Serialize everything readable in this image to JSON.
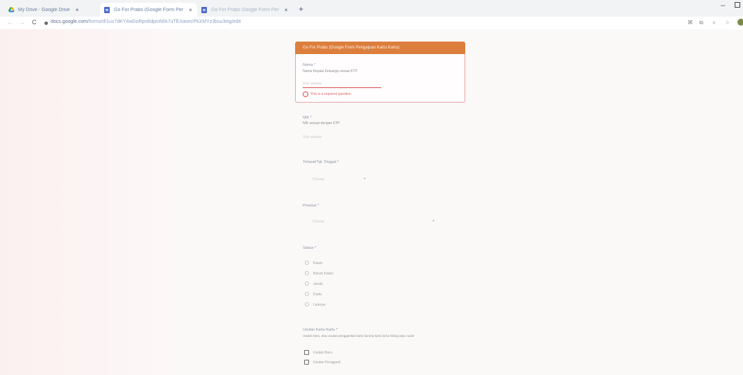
{
  "browser": {
    "tabs": [
      {
        "title": "My Drive - Google Drive",
        "icon": "google-drive-icon",
        "active": false
      },
      {
        "title": "Go For Prabs (Google Form Per",
        "icon": "google-forms-icon",
        "active": true
      },
      {
        "title": "Go For Prabs Google Form Per",
        "icon": "google-forms-icon",
        "active": false
      }
    ],
    "close_glyph": "×",
    "new_tab_glyph": "+",
    "minimize_glyph": "–",
    "url_host": "docs.google.com",
    "url_path": "/forms/d/1uz7dKY4wDoRpn6dpmNfA7uTEXaom/PkXMYz3bsu3eig/edit",
    "back_glyph": "←",
    "forward_glyph": "→",
    "reload_glyph": "C",
    "toolbar_icons": [
      "share-icon",
      "extension-icon",
      "search-icon",
      "star-icon"
    ]
  },
  "form": {
    "header_title": "Go For Prabs (Google Form Pengajuan Kartu Kartu)",
    "name_question": {
      "label": "Nama *",
      "description": "Nama Kepala Keluarga sesuai KTP",
      "placeholder": "Your answer",
      "error": "This is a required question"
    },
    "nik_question": {
      "label": "NIK *",
      "description": "NIK sesuai dengan KTP",
      "placeholder": "Your answer"
    },
    "birth_question": {
      "label": "Tempat/Tgl. Tinggal *",
      "placeholder": "Choose"
    },
    "province_question": {
      "label": "Provinsi *",
      "placeholder": "Choose"
    },
    "status_question": {
      "label": "Status *",
      "options": [
        "Kawin",
        "Belum Kawin",
        "Janda",
        "Duda",
        "Lainnya"
      ]
    },
    "submission_question": {
      "label": "Usulan Kartu Kartu *",
      "description": "Usulan baru, atau usulan penggantian kartu karena kartu lama hilang atau rusak",
      "options": [
        "Usulan Baru",
        "Usulan Pengganti"
      ]
    }
  }
}
